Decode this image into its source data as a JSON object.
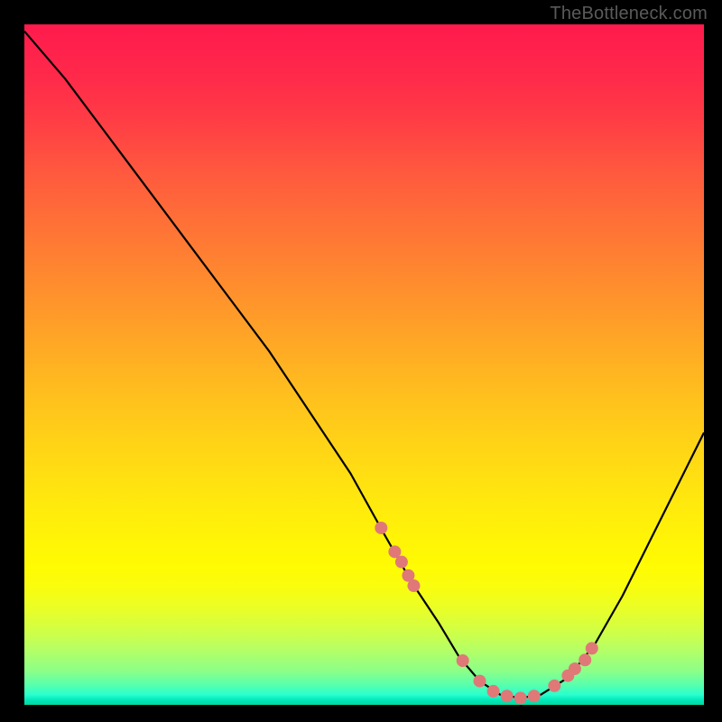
{
  "watermark": "TheBottleneck.com",
  "chart_data": {
    "type": "line",
    "title": "",
    "xlabel": "",
    "ylabel": "",
    "xlim": [
      0,
      100
    ],
    "ylim": [
      0,
      100
    ],
    "series": [
      {
        "name": "curve",
        "x": [
          0,
          6,
          12,
          18,
          24,
          30,
          36,
          42,
          48,
          53,
          57,
          61,
          64,
          67,
          70,
          73,
          76,
          80,
          84,
          88,
          92,
          96,
          100
        ],
        "y": [
          99,
          92,
          84,
          76,
          68,
          60,
          52,
          43,
          34,
          25,
          18,
          12,
          7,
          3.5,
          1.5,
          1,
          1.5,
          4,
          9,
          16,
          24,
          32,
          40
        ]
      }
    ],
    "scatter_points": {
      "name": "markers",
      "x": [
        52.5,
        54.5,
        55.5,
        56.5,
        57.3,
        64.5,
        67.0,
        69.0,
        71.0,
        73.0,
        75.0,
        78.0,
        80.0,
        81.0,
        82.5,
        83.5
      ],
      "y": [
        26.0,
        22.5,
        21.0,
        19.0,
        17.5,
        6.5,
        3.5,
        2.0,
        1.3,
        1.0,
        1.3,
        2.8,
        4.3,
        5.3,
        6.6,
        8.3
      ]
    },
    "colors": {
      "curve": "#000000",
      "markers": "#e07878",
      "background_top": "#ff1a4d",
      "background_bottom": "#00d8a0"
    }
  }
}
